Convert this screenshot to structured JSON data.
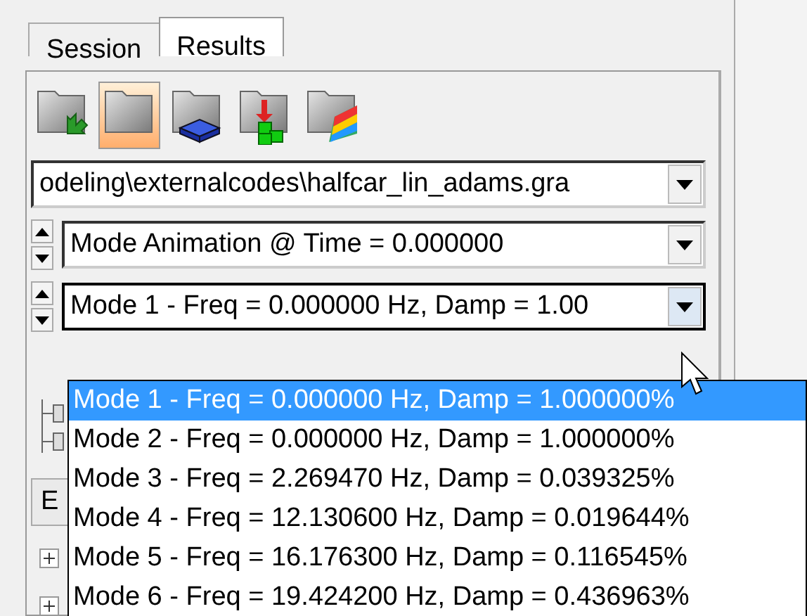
{
  "tabs": [
    {
      "label": "Session",
      "selected": false
    },
    {
      "label": "Results",
      "selected": true
    }
  ],
  "toolbar": [
    {
      "kind": "load",
      "selected": false
    },
    {
      "kind": "blank",
      "selected": true
    },
    {
      "kind": "cube",
      "selected": false
    },
    {
      "kind": "add",
      "selected": false
    },
    {
      "kind": "contour",
      "selected": false
    }
  ],
  "file_combo": {
    "value": "odeling\\externalcodes\\halfcar_lin_adams.gra"
  },
  "animation_combo": {
    "value": "Mode Animation @ Time = 0.000000"
  },
  "mode_combo": {
    "value": "Mode 1 - Freq = 0.000000 Hz, Damp = 1.00",
    "expanded": true
  },
  "mode_list": [
    {
      "label": "Mode 1 - Freq = 0.000000 Hz, Damp = 1.000000%",
      "selected": true
    },
    {
      "label": "Mode 2 - Freq = 0.000000 Hz, Damp = 1.000000%",
      "selected": false
    },
    {
      "label": "Mode 3 - Freq = 2.269470 Hz, Damp = 0.039325%",
      "selected": false
    },
    {
      "label": "Mode 4 - Freq = 12.130600 Hz, Damp = 0.019644%",
      "selected": false
    },
    {
      "label": "Mode 5 - Freq = 16.176300 Hz, Damp = 0.116545%",
      "selected": false
    },
    {
      "label": "Mode 6 - Freq = 19.424200 Hz, Damp = 0.436963%",
      "selected": false
    }
  ],
  "partial_button": {
    "label": "E"
  }
}
